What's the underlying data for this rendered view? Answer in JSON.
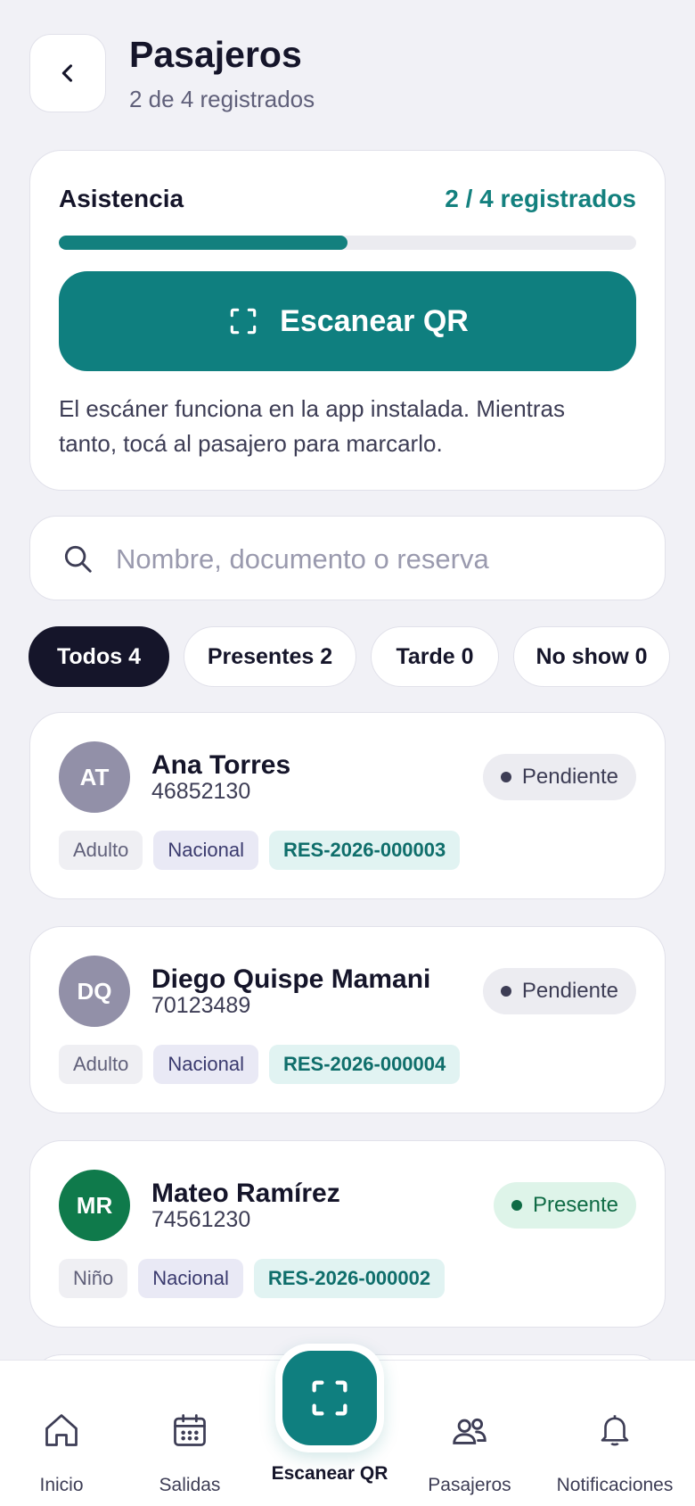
{
  "header": {
    "title": "Pasajeros",
    "subtitle": "2 de 4 registrados"
  },
  "attendance": {
    "label": "Asistencia",
    "count": "2 / 4 registrados",
    "progress_percent": 50,
    "scan_button": "Escanear QR",
    "note": "El escáner funciona en la app instalada. Mientras tanto, tocá al pasajero para marcarlo."
  },
  "search": {
    "placeholder": "Nombre, documento o reserva",
    "value": ""
  },
  "filters": [
    {
      "label": "Todos 4",
      "active": true
    },
    {
      "label": "Presentes 2",
      "active": false
    },
    {
      "label": "Tarde 0",
      "active": false
    },
    {
      "label": "No show 0",
      "active": false
    }
  ],
  "passengers": [
    {
      "initials": "AT",
      "name": "Ana Torres",
      "document": "46852130",
      "status": "Pendiente",
      "tags": [
        "Adulto",
        "Nacional",
        "RES-2026-000003"
      ]
    },
    {
      "initials": "DQ",
      "name": "Diego Quispe Mamani",
      "document": "70123489",
      "status": "Pendiente",
      "tags": [
        "Adulto",
        "Nacional",
        "RES-2026-000004"
      ]
    },
    {
      "initials": "MR",
      "name": "Mateo Ramírez",
      "document": "74561230",
      "status": "Presente",
      "tags": [
        "Niño",
        "Nacional",
        "RES-2026-000002"
      ]
    }
  ],
  "colors": {
    "accent": "#0f7f7f",
    "avatar_pending": "#9290a8",
    "avatar_present": "#0f7a4b"
  },
  "nav": {
    "items": [
      {
        "label": "Inicio",
        "icon": "home-icon"
      },
      {
        "label": "Salidas",
        "icon": "calendar-icon"
      },
      {
        "label": "Escanear QR",
        "icon": "scan-icon"
      },
      {
        "label": "Pasajeros",
        "icon": "users-icon"
      },
      {
        "label": "Notificaciones",
        "icon": "bell-icon"
      }
    ]
  }
}
